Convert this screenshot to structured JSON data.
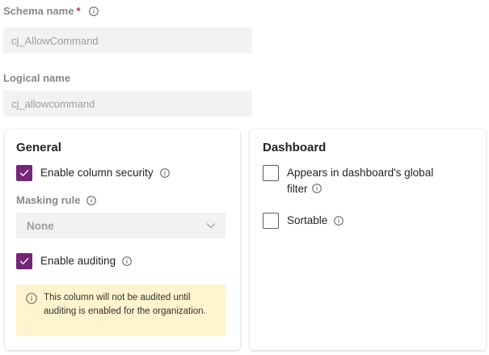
{
  "schema_name": {
    "label": "Schema name",
    "required_mark": "*",
    "value": "cj_AllowCommand"
  },
  "logical_name": {
    "label": "Logical name",
    "value": "cj_allowcommand"
  },
  "general": {
    "title": "General",
    "column_security": {
      "label": "Enable column security",
      "checked": true
    },
    "masking_rule": {
      "label": "Masking rule",
      "value": "None"
    },
    "auditing": {
      "label": "Enable auditing",
      "checked": true
    },
    "warning_text": "This column will not be audited until auditing is enabled for the organization."
  },
  "dashboard": {
    "title": "Dashboard",
    "global_filter": {
      "label": "Appears in dashboard's global filter",
      "checked": false
    },
    "sortable": {
      "label": "Sortable",
      "checked": false
    }
  },
  "colors": {
    "checkbox_checked": "#742774",
    "warning_bg": "#fff4ce",
    "required": "#c4314b"
  }
}
